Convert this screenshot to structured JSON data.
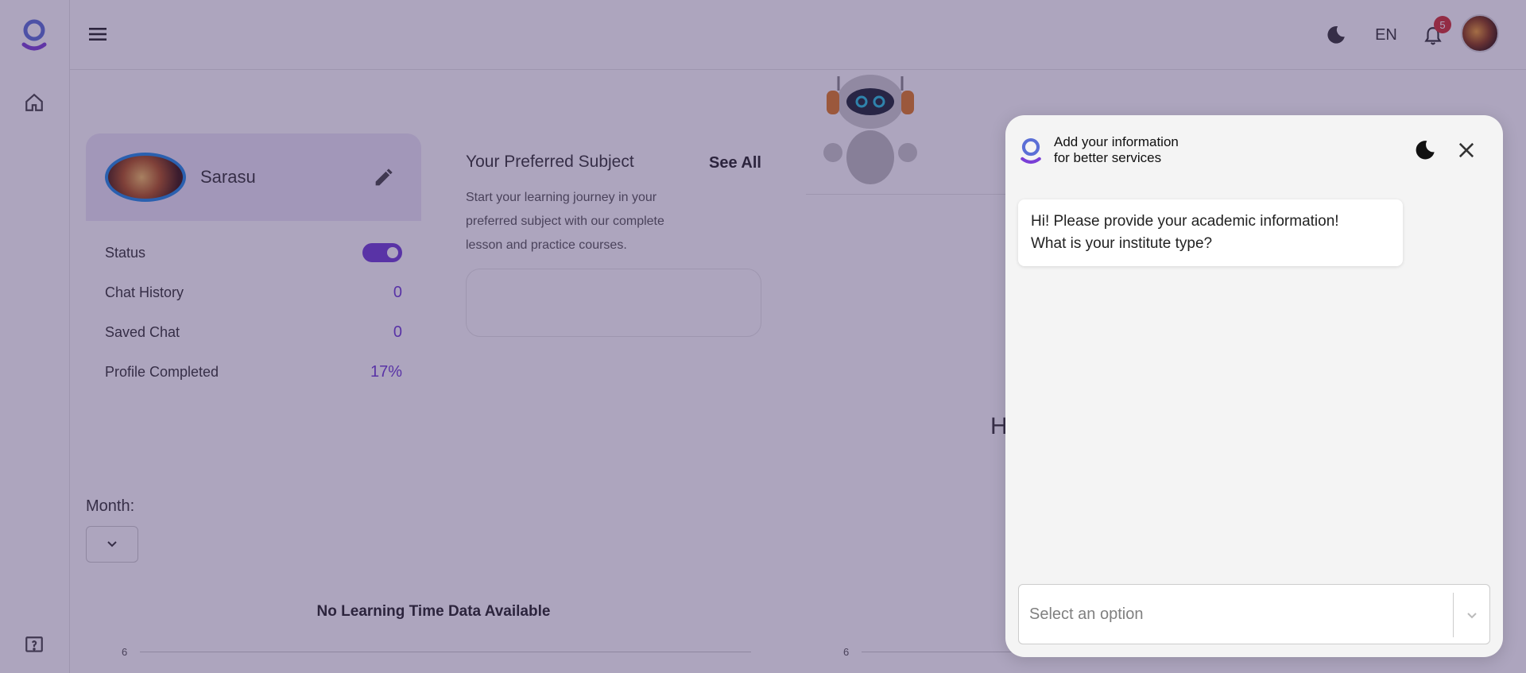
{
  "topbar": {
    "language": "EN",
    "notification_count": "5"
  },
  "profile": {
    "name": "Sarasu",
    "stats": [
      {
        "label": "Status",
        "value": ""
      },
      {
        "label": "Chat History",
        "value": "0"
      },
      {
        "label": "Saved Chat",
        "value": "0"
      },
      {
        "label": "Profile Completed",
        "value": "17%"
      }
    ],
    "status_on": true
  },
  "subject_card": {
    "title": "Your Preferred Subject",
    "see_all": "See All",
    "description": "Start your learning journey in your preferred subject with our complete lesson and practice courses."
  },
  "third_card": {
    "partial_text": "H"
  },
  "filters": {
    "month_label": "Month:"
  },
  "charts": [
    {
      "title": "No Learning Time Data Available",
      "tick": "6"
    },
    {
      "title": "",
      "tick": "6"
    }
  ],
  "modal": {
    "title_line1": "Add your information",
    "title_line2": "for better services",
    "message_line1": "Hi! Please provide your academic information!",
    "message_line2": "What is your institute type?",
    "select_placeholder": "Select an option"
  },
  "colors": {
    "accent": "#6f3bd6",
    "overlay": "rgba(60,40,100,0.42)",
    "badge": "#d32f2f"
  }
}
